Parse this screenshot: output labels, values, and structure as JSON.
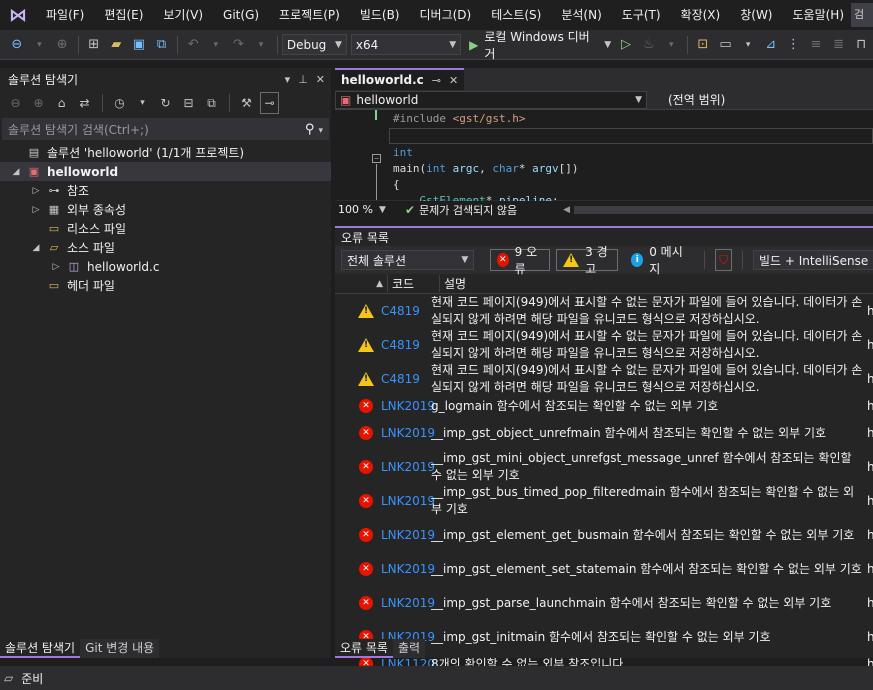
{
  "menu": {
    "items": [
      "파일(F)",
      "편집(E)",
      "보기(V)",
      "Git(G)",
      "프로젝트(P)",
      "빌드(B)",
      "디버그(D)",
      "테스트(S)",
      "분석(N)",
      "도구(T)",
      "확장(X)",
      "창(W)",
      "도움말(H)"
    ],
    "search_label": "검"
  },
  "toolbar": {
    "config": "Debug",
    "platform": "x64",
    "run_label": "로컬 Windows 디버거"
  },
  "solution_explorer": {
    "title": "솔루션 탐색기",
    "search_placeholder": "솔루션 탐색기 검색(Ctrl+;)",
    "tree": [
      {
        "label": "솔루션 'helloworld' (1/1개 프로젝트)",
        "level": 0,
        "icon": "solution-icon",
        "expander": ""
      },
      {
        "label": "helloworld",
        "level": 0,
        "icon": "cpp-project-icon",
        "expander": "◢",
        "selected": true
      },
      {
        "label": "참조",
        "level": 1,
        "icon": "references-icon",
        "expander": "▷"
      },
      {
        "label": "외부 종속성",
        "level": 1,
        "icon": "external-dependencies-icon",
        "expander": "▷"
      },
      {
        "label": "리소스 파일",
        "level": 1,
        "icon": "folder-icon",
        "expander": ""
      },
      {
        "label": "소스 파일",
        "level": 1,
        "icon": "folder-open-icon",
        "expander": "◢"
      },
      {
        "label": "helloworld.c",
        "level": 2,
        "icon": "c-file-icon",
        "expander": "▷"
      },
      {
        "label": "헤더 파일",
        "level": 1,
        "icon": "folder-icon",
        "expander": ""
      }
    ],
    "bottom_tabs": [
      "솔루션 탐색기",
      "Git 변경 내용"
    ]
  },
  "editor": {
    "tab_name": "helloworld.c",
    "nav_file": "helloworld",
    "nav_scope": "(전역 범위)",
    "zoom": "100 %",
    "status": "문제가 검색되지 않음"
  },
  "error_list": {
    "title": "오류 목록",
    "scope": "전체 솔루션",
    "errors_label": "9 오류",
    "warnings_label": "3 경고",
    "messages_label": "0 메시지",
    "build_filter": "빌드 + IntelliSense",
    "col_code": "코드",
    "col_desc": "설명",
    "rows": [
      {
        "type": "warning",
        "code": "C4819",
        "desc": "현재 코드 페이지(949)에서 표시할 수 없는 문자가 파일에 들어 있습니다. 데이터가 손실되지 않게 하려면 해당 파일을 유니코드 형식으로 저장하십시오.",
        "proj": "h"
      },
      {
        "type": "warning",
        "code": "C4819",
        "desc": "현재 코드 페이지(949)에서 표시할 수 없는 문자가 파일에 들어 있습니다. 데이터가 손실되지 않게 하려면 해당 파일을 유니코드 형식으로 저장하십시오.",
        "proj": "h"
      },
      {
        "type": "warning",
        "code": "C4819",
        "desc": "현재 코드 페이지(949)에서 표시할 수 없는 문자가 파일에 들어 있습니다. 데이터가 손실되지 않게 하려면 해당 파일을 유니코드 형식으로 저장하십시오.",
        "proj": "h"
      },
      {
        "type": "error",
        "code": "LNK2019",
        "desc": "g_logmain 함수에서 참조되는 확인할 수 없는 외부 기호",
        "proj": "h"
      },
      {
        "type": "error",
        "code": "LNK2019",
        "desc": "__imp_gst_object_unrefmain 함수에서 참조되는 확인할 수 없는 외부 기호",
        "proj": "h"
      },
      {
        "type": "error",
        "code": "LNK2019",
        "desc": "__imp_gst_mini_object_unrefgst_message_unref 함수에서 참조되는 확인할 수 없는 외부 기호",
        "proj": "h"
      },
      {
        "type": "error",
        "code": "LNK2019",
        "desc": "__imp_gst_bus_timed_pop_filteredmain 함수에서 참조되는 확인할 수 없는 외부 기호",
        "proj": "h"
      },
      {
        "type": "error",
        "code": "LNK2019",
        "desc": "__imp_gst_element_get_busmain 함수에서 참조되는 확인할 수 없는 외부 기호",
        "proj": "h"
      },
      {
        "type": "error",
        "code": "LNK2019",
        "desc": "__imp_gst_element_set_statemain 함수에서 참조되는 확인할 수 없는 외부 기호",
        "proj": "h"
      },
      {
        "type": "error",
        "code": "LNK2019",
        "desc": "__imp_gst_parse_launchmain 함수에서 참조되는 확인할 수 없는 외부 기호",
        "proj": "h"
      },
      {
        "type": "error",
        "code": "LNK2019",
        "desc": "__imp_gst_initmain 함수에서 참조되는 확인할 수 없는 외부 기호",
        "proj": "h"
      },
      {
        "type": "error",
        "code": "LNK1120",
        "desc": "8개의 확인할 수 없는 외부 참조입니다.",
        "proj": "h"
      }
    ],
    "bottom_tabs": [
      "오류 목록",
      "출력"
    ]
  },
  "statusbar": {
    "text": "준비"
  }
}
